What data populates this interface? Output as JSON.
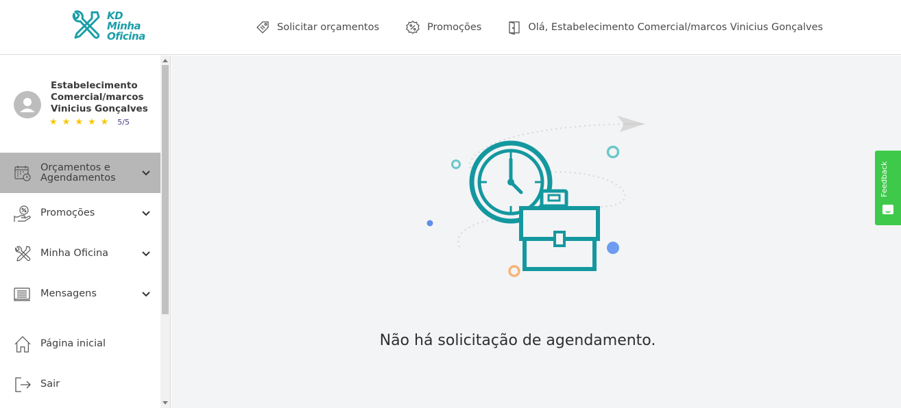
{
  "brand": {
    "line1": "KD",
    "line2": "Minha",
    "line3": "Oficina",
    "color": "#1a9ea8"
  },
  "header": {
    "nav": [
      {
        "label": "Solicitar orçamentos",
        "icon": "price-tag-icon"
      },
      {
        "label": "Promoções",
        "icon": "percent-badge-icon"
      },
      {
        "label": "Olá, Estabelecimento Comercial/marcos Vinicius Gonçalves",
        "icon": "door-icon"
      }
    ]
  },
  "profile": {
    "name": "Estabelecimento Comercial/marcos Vinicius Gonçalves",
    "stars": 5,
    "rating_text": "5/5",
    "star_color": "#f7c600"
  },
  "sidebar": {
    "items": [
      {
        "label": "Orçamentos e Agendamentos",
        "icon": "calendar-clock-icon",
        "active": true
      },
      {
        "label": "Promoções",
        "icon": "hand-percent-icon"
      },
      {
        "label": "Minha Oficina",
        "icon": "tools-icon"
      },
      {
        "label": "Mensagens",
        "icon": "message-list-icon"
      }
    ],
    "bottom": [
      {
        "label": "Página inicial",
        "icon": "home-icon"
      },
      {
        "label": "Sair",
        "icon": "logout-icon"
      }
    ]
  },
  "main": {
    "empty_message": "Não há solicitação de agendamento.",
    "illustration": "clock-briefcase-icon",
    "accent": "#14989f"
  },
  "feedback": {
    "label": "Feedback",
    "color": "#3fc94b"
  }
}
